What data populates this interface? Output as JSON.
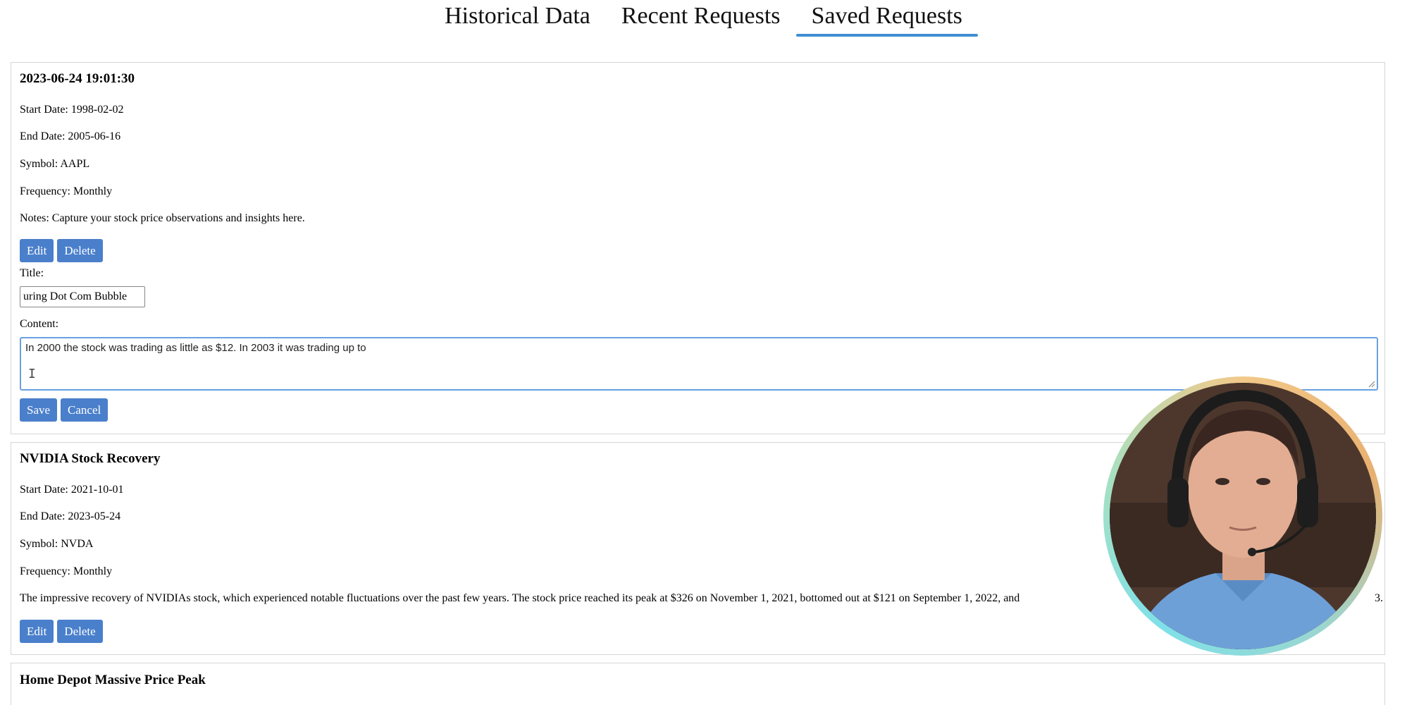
{
  "tabs": [
    {
      "label": "Historical Data",
      "active": false
    },
    {
      "label": "Recent Requests",
      "active": false
    },
    {
      "label": "Saved Requests",
      "active": true
    }
  ],
  "card1": {
    "title": "2023-06-24 19:01:30",
    "start_date": "Start Date: 1998-02-02",
    "end_date": "End Date: 2005-06-16",
    "symbol": "Symbol: AAPL",
    "frequency": "Frequency: Monthly",
    "notes": "Notes: Capture your stock price observations and insights here.",
    "edit_label": "Edit",
    "delete_label": "Delete",
    "title_label": "Title:",
    "title_value": "uring Dot Com Bubble",
    "content_label": "Content:",
    "content_value": "In 2000 the stock was trading as little as $12. In 2003 it was trading up to",
    "save_label": "Save",
    "cancel_label": "Cancel"
  },
  "card2": {
    "title": "NVIDIA Stock Recovery",
    "start_date": "Start Date: 2021-10-01",
    "end_date": "End Date: 2023-05-24",
    "symbol": "Symbol: NVDA",
    "frequency": "Frequency: Monthly",
    "notes_visible_left": "The impressive recovery of NVIDIAs stock, which experienced notable fluctuations over the past few years. The stock price reached its peak at $326 on November 1, 2021, bottomed out at $121 on September 1, 2022, and",
    "notes_visible_right": "3.",
    "edit_label": "Edit",
    "delete_label": "Delete"
  },
  "card3": {
    "title": "Home Depot Massive Price Peak"
  },
  "colors": {
    "button_bg": "#4a7fcb",
    "tab_underline": "#3f8fd2",
    "focus_border": "#6aa0e0"
  },
  "icons": {
    "text_cursor": "I",
    "resize": "resize-grip-icon"
  }
}
